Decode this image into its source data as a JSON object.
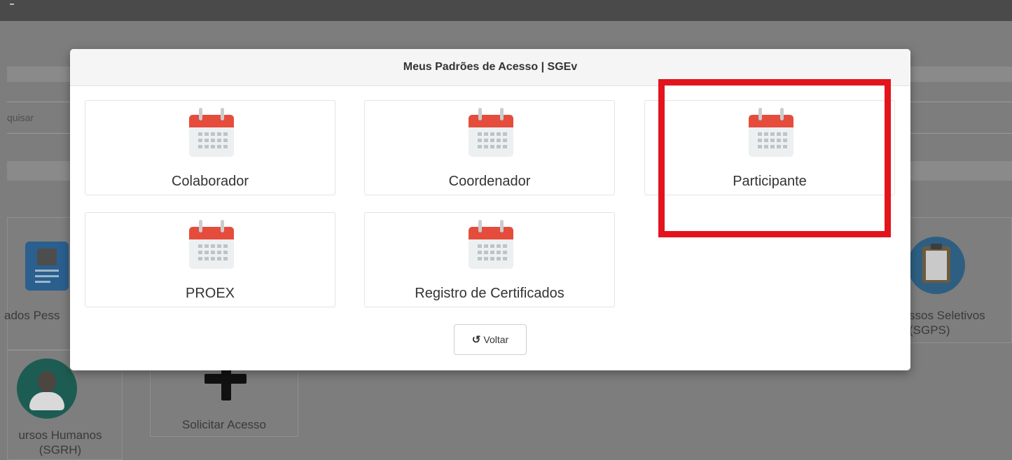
{
  "background": {
    "search_text": "quisar",
    "apps": {
      "dados_pessoais": "ados Pess",
      "recursos_humanos": "ursos Humanos\n(SGRH)",
      "processos_seletivos": "ssos Seletivos\n(SGPS)",
      "solicitar_acesso": "Solicitar Acesso"
    }
  },
  "modal": {
    "title": "Meus Padrões de Acesso | SGEv",
    "options": [
      {
        "label": "Colaborador",
        "icon": "calendar-icon"
      },
      {
        "label": "Coordenador",
        "icon": "calendar-icon"
      },
      {
        "label": "Participante",
        "icon": "calendar-icon"
      },
      {
        "label": "PROEX",
        "icon": "calendar-icon"
      },
      {
        "label": "Registro de Certificados",
        "icon": "calendar-icon"
      }
    ],
    "back_button": {
      "label": "Voltar",
      "icon": "undo-icon"
    }
  },
  "colors": {
    "calendar_red": "#e64c3c",
    "calendar_body": "#ecf0f1",
    "highlight": "#e3141c"
  }
}
